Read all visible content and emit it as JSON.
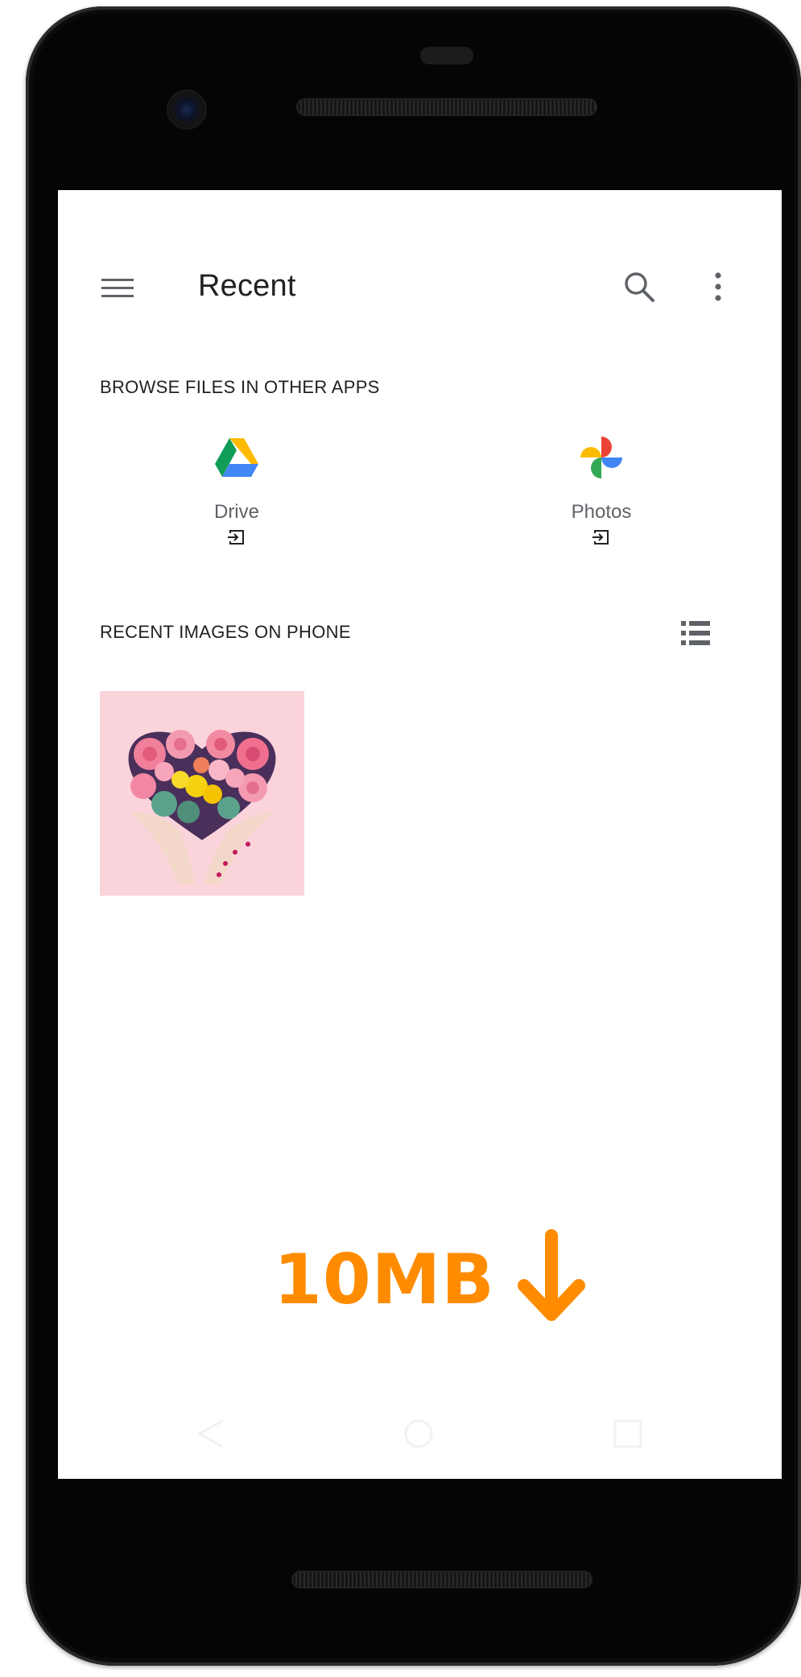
{
  "toolbar": {
    "title": "Recent",
    "menu_icon": "hamburger-menu-icon",
    "search_icon": "search-icon",
    "more_icon": "more-vert-icon"
  },
  "browse_section": {
    "header": "BROWSE FILES IN OTHER APPS",
    "apps": [
      {
        "name": "Drive",
        "icon": "google-drive-icon",
        "open_icon": "open-in-app-icon"
      },
      {
        "name": "Photos",
        "icon": "google-photos-icon",
        "open_icon": "open-in-app-icon"
      }
    ]
  },
  "recent_section": {
    "header": "RECENT IMAGES ON PHONE",
    "view_toggle_icon": "list-view-icon",
    "images": [
      {
        "description_icon": "image-thumbnail"
      }
    ]
  },
  "overlay": {
    "size_text": "10MB",
    "arrow_icon": "arrow-down-icon",
    "color": "#ff8c00"
  },
  "colors": {
    "text_primary": "#202124",
    "text_secondary": "#5f6368",
    "phone_body": "#050505",
    "accent_orange": "#ff8c00"
  }
}
